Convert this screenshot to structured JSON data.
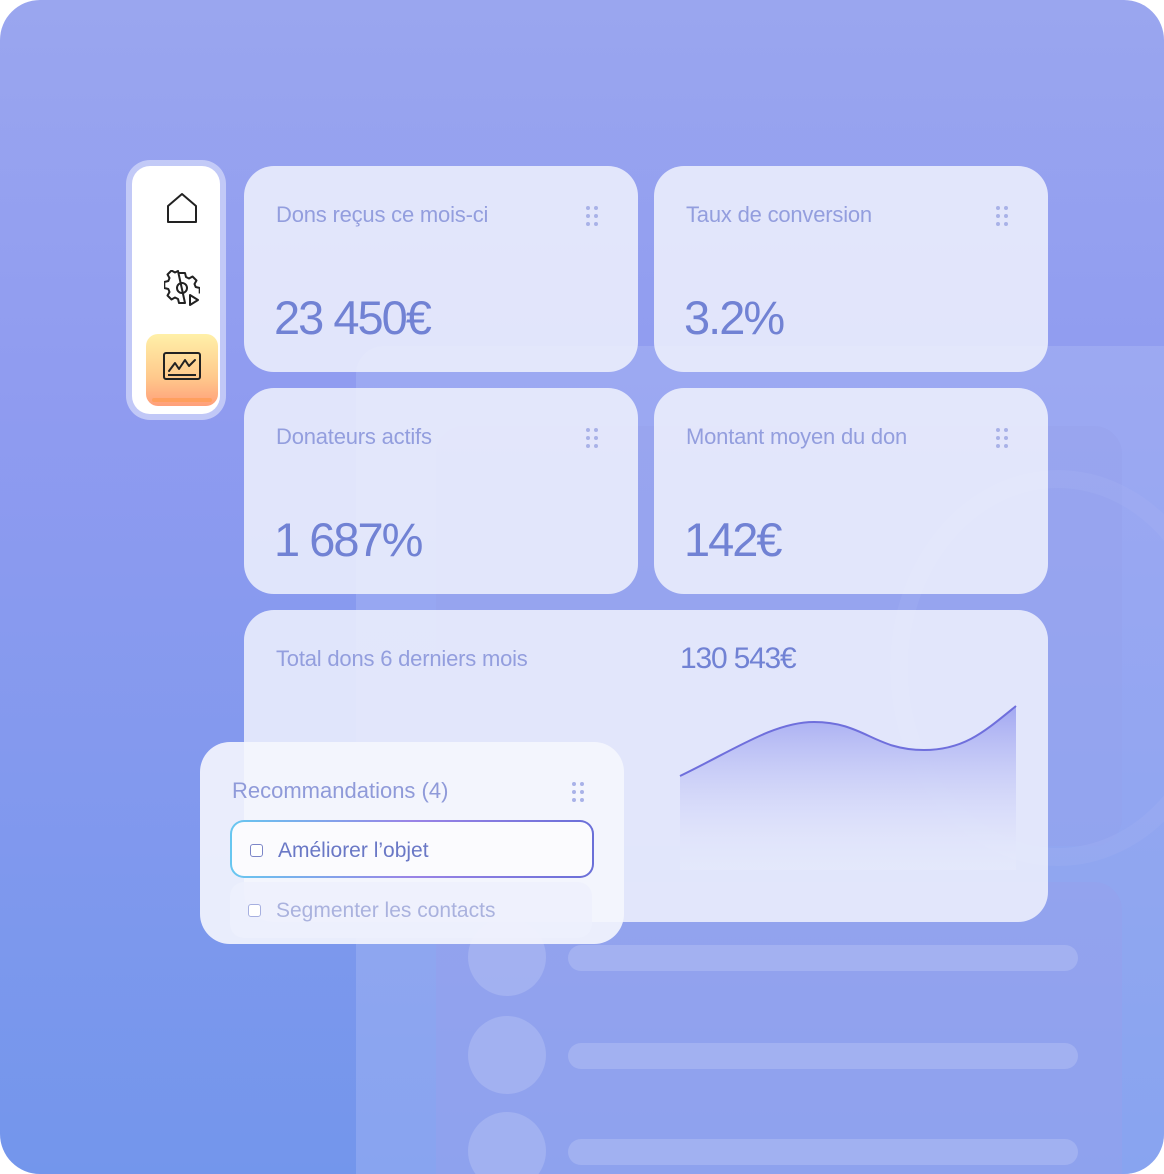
{
  "sidebar": {
    "items": [
      {
        "icon": "home-icon",
        "active": false
      },
      {
        "icon": "settings-play-icon",
        "active": true,
        "note": ""
      },
      {
        "icon": "chart-icon",
        "active": true
      }
    ]
  },
  "cards": [
    {
      "title": "Dons reçus ce mois-ci",
      "value": "23 450€"
    },
    {
      "title": "Taux de conversion",
      "value": "3.2%"
    },
    {
      "title": "Donateurs actifs",
      "value": "1 687%"
    },
    {
      "title": "Montant moyen du don",
      "value": "142€"
    }
  ],
  "total": {
    "title": "Total dons 6 derniers mois",
    "value": "130 543€"
  },
  "recommendations": {
    "title": "Recommandations (4)",
    "items": [
      {
        "label": "Améliorer l’objet",
        "selected": true
      },
      {
        "label": "Segmenter les contacts",
        "selected": false
      }
    ]
  },
  "colors": {
    "accent": "#7182d4",
    "chart_line": "#6f6fdc",
    "active_icon_bg": "#ffd48f"
  }
}
